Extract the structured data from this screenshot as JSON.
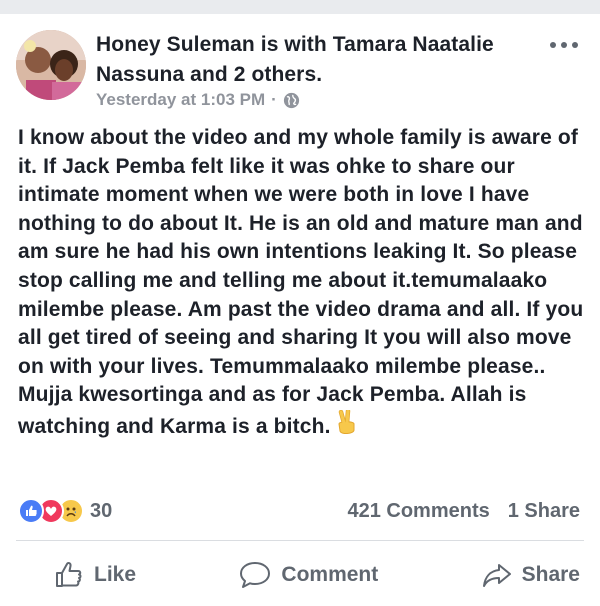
{
  "post": {
    "author_line": "Honey Suleman is with Tamara Naatalie Nassuna and 2 others.",
    "timestamp": "Yesterday at 1:03 PM",
    "separator": "·",
    "privacy_icon": "globe-icon",
    "more_icon": "more-options-icon",
    "body": "I know about the video and my whole  family is aware of it. If Jack Pemba felt like it was ohke to share our intimate moment  when we were both in love I have nothing to do about It. He is an old and mature man and am sure he had his own intentions leaking It. So please stop calling me and telling me about it.temumalaako milembe  please. Am past the video drama and all. If you all get tired of seeing and sharing It you will also move on with your lives. Temummalaako milembe please.. Mujja kwesortinga and as for Jack Pemba. Allah is watching and Karma is a bitch.",
    "body_emoji": "victory-hand-emoji"
  },
  "stats": {
    "reaction_icons": [
      "like-reaction-icon",
      "love-reaction-icon",
      "sad-reaction-icon"
    ],
    "reaction_count": "30",
    "comments": "421 Comments",
    "shares": "1 Share"
  },
  "actions": {
    "like_label": "Like",
    "comment_label": "Comment",
    "share_label": "Share"
  },
  "colors": {
    "text": "#1d2129",
    "secondary": "#606770",
    "meta": "#90949c",
    "like_blue": "#4a7cf6",
    "love_red": "#f0395d",
    "sad_yellow": "#f7c84b"
  }
}
